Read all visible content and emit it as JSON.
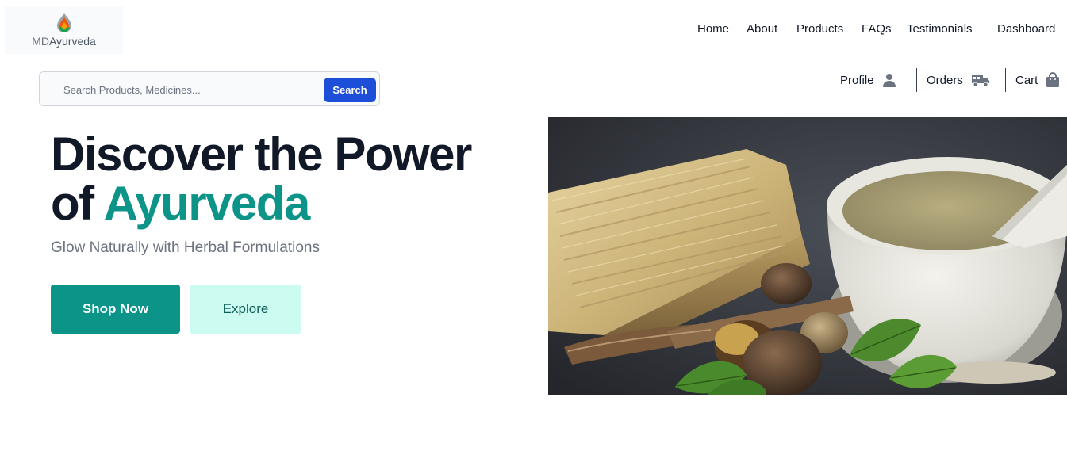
{
  "brand": {
    "logo_part1": "MD",
    "logo_part2": "Ayurveda",
    "logo_icon": "flame-drop-icon"
  },
  "nav": {
    "items": [
      "Home",
      "About",
      "Products",
      "FAQs",
      "Testimonials",
      "Dashboard"
    ]
  },
  "utility": {
    "profile_label": "Profile",
    "profile_icon": "user-icon",
    "orders_label": "Orders",
    "orders_icon": "truck-icon",
    "cart_label": "Cart",
    "cart_icon": "shopping-bag-icon"
  },
  "search": {
    "placeholder": "Search Products, Medicines...",
    "value": "",
    "button_label": "Search",
    "button_color": "#1d4ed8"
  },
  "hero": {
    "title_line1": "Discover the Power",
    "title_of": "of",
    "title_accent": "Ayurveda",
    "subtitle": "Glow Naturally with Herbal Formulations",
    "primary_label": "Shop Now",
    "secondary_label": "Explore",
    "accent_color": "#0d9488",
    "secondary_bg": "#ccfbf1"
  },
  "image": {
    "subject": "herbs-mortar-pestle-image"
  }
}
